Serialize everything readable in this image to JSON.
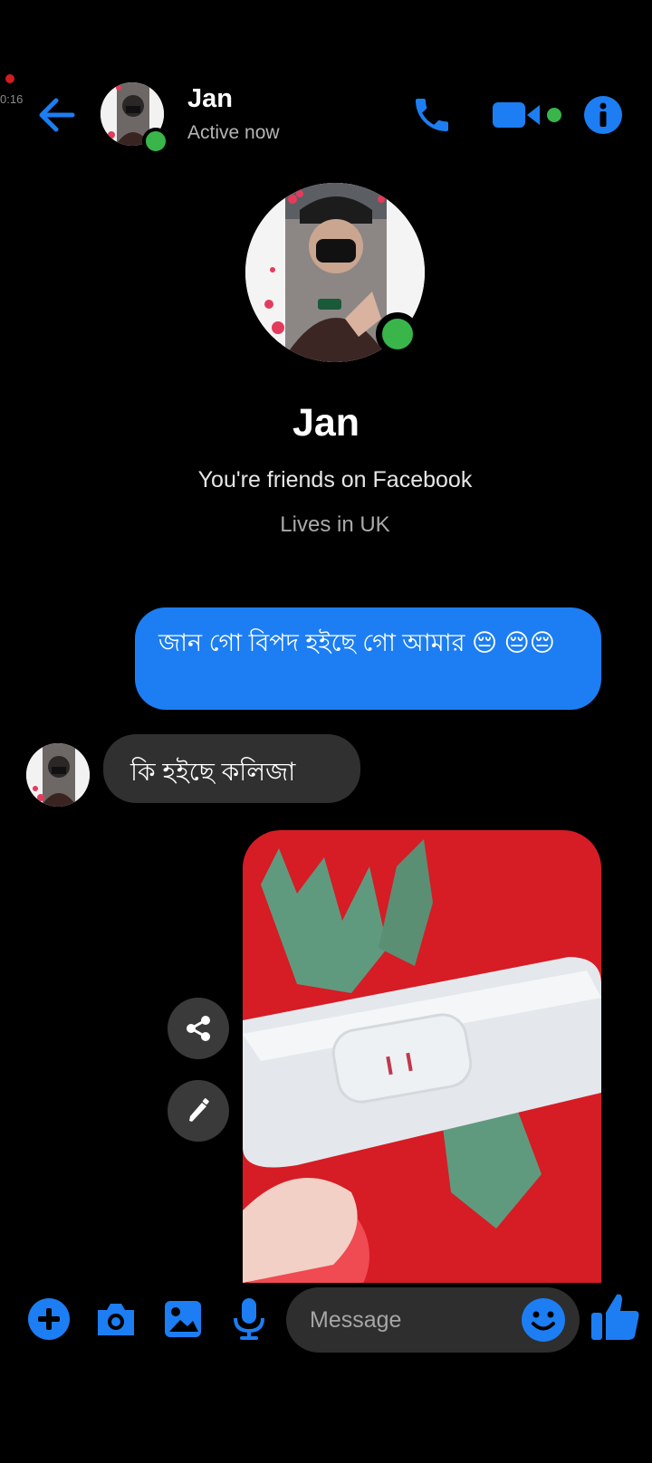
{
  "recording": {
    "time": "0:16"
  },
  "header": {
    "name": "Jan",
    "status": "Active now",
    "icons": [
      "back-arrow-icon",
      "phone-icon",
      "video-camera-icon",
      "info-icon"
    ]
  },
  "profile": {
    "name": "Jan",
    "friends_text": "You're friends on Facebook",
    "lives_text": "Lives in UK"
  },
  "messages": [
    {
      "direction": "outgoing",
      "text": "জান গো বিপদ হইছে গো আমার 😔 😔😔"
    },
    {
      "direction": "incoming",
      "text": "কি হইছে কলিজা"
    },
    {
      "direction": "outgoing",
      "type": "photo"
    }
  ],
  "composer": {
    "placeholder": "Message",
    "icons": [
      "plus-icon",
      "camera-icon",
      "gallery-icon",
      "microphone-icon",
      "emoji-icon",
      "thumbs-up-icon"
    ]
  },
  "colors": {
    "accent": "#1c7ef2",
    "online": "#39b54a",
    "bubble_in": "#303030"
  }
}
